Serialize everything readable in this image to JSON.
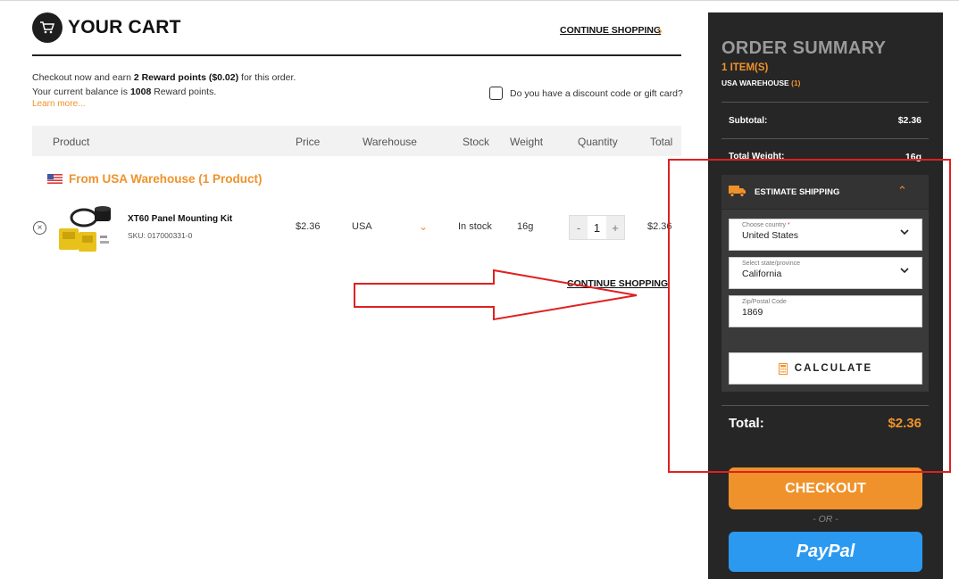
{
  "colors": {
    "accent": "#f0922b",
    "sidebar_bg": "#262626",
    "paypal": "#2b99f0",
    "annotation_red": "#e02020"
  },
  "header": {
    "title": "YOUR CART",
    "icon": "cart-icon",
    "continue_shopping": "CONTINUE SHOPPING"
  },
  "reward": {
    "line1_pre": "Checkout now and earn ",
    "line1_bold": "2 Reward points ($0.02)",
    "line1_post": " for this order.",
    "line2_pre": "Your current balance is ",
    "line2_bold": "1008",
    "line2_post": " Reward points.",
    "learn_more": "Learn more..."
  },
  "discount": {
    "label": "Do you have a discount code or gift card?",
    "checked": false
  },
  "table": {
    "headers": [
      "Product",
      "Price",
      "Warehouse",
      "Stock",
      "Weight",
      "Quantity",
      "Total"
    ],
    "group_label": "From USA Warehouse (1 Product)",
    "rows": [
      {
        "name": "XT60 Panel Mounting Kit",
        "sku": "SKU: 017000331-0",
        "price": "$2.36",
        "warehouse": "USA",
        "stock": "In stock",
        "weight": "16g",
        "quantity": "1",
        "total": "$2.36"
      }
    ],
    "qty_minus": "-",
    "qty_plus": "+"
  },
  "continue_shopping_bottom": "CONTINUE SHOPPING",
  "summary": {
    "title": "ORDER SUMMARY",
    "items": "1 ITEM(S)",
    "warehouse_label": "USA WAREHOUSE",
    "warehouse_count": "(1)",
    "subtotal_label": "Subtotal:",
    "subtotal_value": "$2.36",
    "weight_label": "Total Weight:",
    "weight_value": "16g",
    "shipping": {
      "title": "ESTIMATE SHIPPING",
      "country_label": "Choose country",
      "country_required": "*",
      "country_value": "United States",
      "state_label": "Select state/province",
      "state_value": "California",
      "zip_label": "Zip/Postal Code",
      "zip_value": "1869",
      "calculate": "CALCULATE"
    },
    "total_label": "Total:",
    "total_value": "$2.36",
    "checkout": "CHECKOUT",
    "or": "- OR -",
    "paypal": "PayPal"
  }
}
